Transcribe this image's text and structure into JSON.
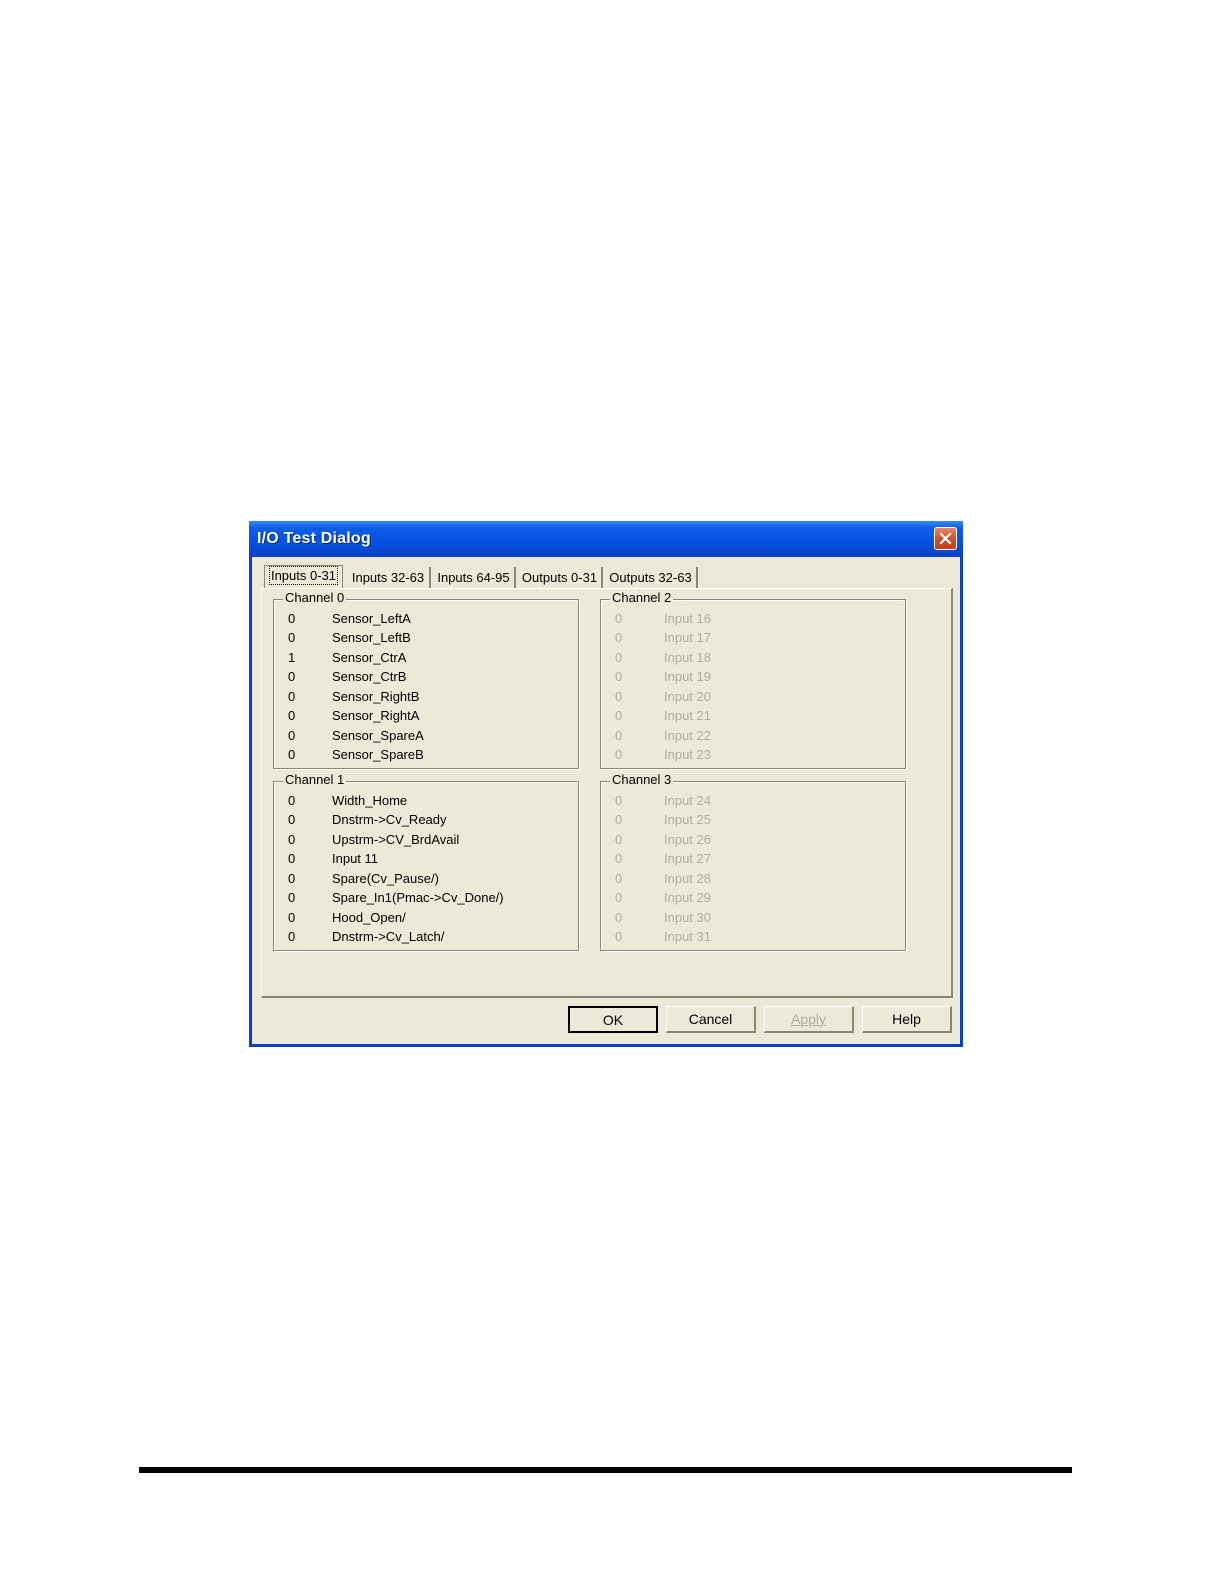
{
  "window": {
    "title": "I/O Test Dialog",
    "close_icon": "close-icon"
  },
  "tabs": [
    {
      "label": "Inputs 0-31",
      "active": true
    },
    {
      "label": "Inputs 32-63",
      "active": false
    },
    {
      "label": "Inputs 64-95",
      "active": false
    },
    {
      "label": "Outputs 0-31",
      "active": false
    },
    {
      "label": "Outputs 32-63",
      "active": false
    }
  ],
  "channels": [
    {
      "label": "Channel 0",
      "enabled": true,
      "rows": [
        {
          "value": "0",
          "name": "Sensor_LeftA"
        },
        {
          "value": "0",
          "name": "Sensor_LeftB"
        },
        {
          "value": "1",
          "name": "Sensor_CtrA"
        },
        {
          "value": "0",
          "name": "Sensor_CtrB"
        },
        {
          "value": "0",
          "name": "Sensor_RightB"
        },
        {
          "value": "0",
          "name": "Sensor_RightA"
        },
        {
          "value": "0",
          "name": "Sensor_SpareA"
        },
        {
          "value": "0",
          "name": "Sensor_SpareB"
        }
      ]
    },
    {
      "label": "Channel 1",
      "enabled": true,
      "rows": [
        {
          "value": "0",
          "name": "Width_Home"
        },
        {
          "value": "0",
          "name": "Dnstrm->Cv_Ready"
        },
        {
          "value": "0",
          "name": "Upstrm->CV_BrdAvail"
        },
        {
          "value": "0",
          "name": "Input 11"
        },
        {
          "value": "0",
          "name": "Spare(Cv_Pause/)"
        },
        {
          "value": "0",
          "name": "Spare_In1(Pmac->Cv_Done/)"
        },
        {
          "value": "0",
          "name": "Hood_Open/"
        },
        {
          "value": "0",
          "name": "Dnstrm->Cv_Latch/"
        }
      ]
    },
    {
      "label": "Channel 2",
      "enabled": false,
      "rows": [
        {
          "value": "0",
          "name": "Input 16"
        },
        {
          "value": "0",
          "name": "Input 17"
        },
        {
          "value": "0",
          "name": "Input 18"
        },
        {
          "value": "0",
          "name": "Input 19"
        },
        {
          "value": "0",
          "name": "Input 20"
        },
        {
          "value": "0",
          "name": "Input 21"
        },
        {
          "value": "0",
          "name": "Input 22"
        },
        {
          "value": "0",
          "name": "Input 23"
        }
      ]
    },
    {
      "label": "Channel 3",
      "enabled": false,
      "rows": [
        {
          "value": "0",
          "name": "Input 24"
        },
        {
          "value": "0",
          "name": "Input 25"
        },
        {
          "value": "0",
          "name": "Input 26"
        },
        {
          "value": "0",
          "name": "Input 27"
        },
        {
          "value": "0",
          "name": "Input 28"
        },
        {
          "value": "0",
          "name": "Input 29"
        },
        {
          "value": "0",
          "name": "Input 30"
        },
        {
          "value": "0",
          "name": "Input 31"
        }
      ]
    }
  ],
  "buttons": {
    "ok": "OK",
    "cancel": "Cancel",
    "apply": "Apply",
    "help": "Help"
  },
  "colors": {
    "title_bar": "#0451e2",
    "dialog_face": "#ece9d8",
    "disabled_text": "#b0ad9c",
    "close_button": "#d44e2a"
  }
}
